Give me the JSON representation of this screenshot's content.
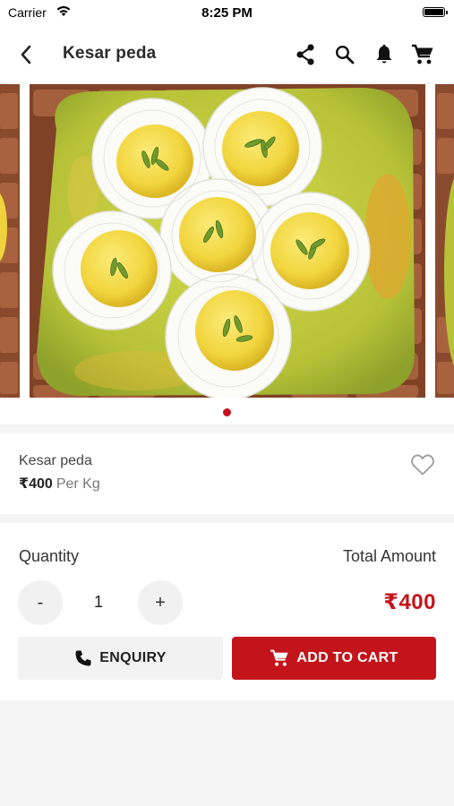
{
  "status_bar": {
    "carrier": "Carrier",
    "time": "8:25 PM"
  },
  "header": {
    "title": "Kesar peda",
    "icons": [
      "back-arrow-icon",
      "share-icon",
      "search-icon",
      "bell-icon",
      "cart-icon"
    ]
  },
  "carousel": {
    "image": "kesar-peda-photo",
    "page_count": 1,
    "active_page": 1
  },
  "product": {
    "name": "Kesar peda",
    "price": "₹400",
    "unit": "Per Kg",
    "favorite": false
  },
  "quantity_section": {
    "quantity_label": "Quantity",
    "total_label": "Total Amount",
    "decrement": "-",
    "increment": "+",
    "quantity": "1",
    "total": "₹400"
  },
  "actions": {
    "enquiry": "ENQUIRY",
    "add_to_cart": "ADD TO CART"
  },
  "colors": {
    "accent": "#c4141b",
    "button_light": "#f2f2f2"
  }
}
